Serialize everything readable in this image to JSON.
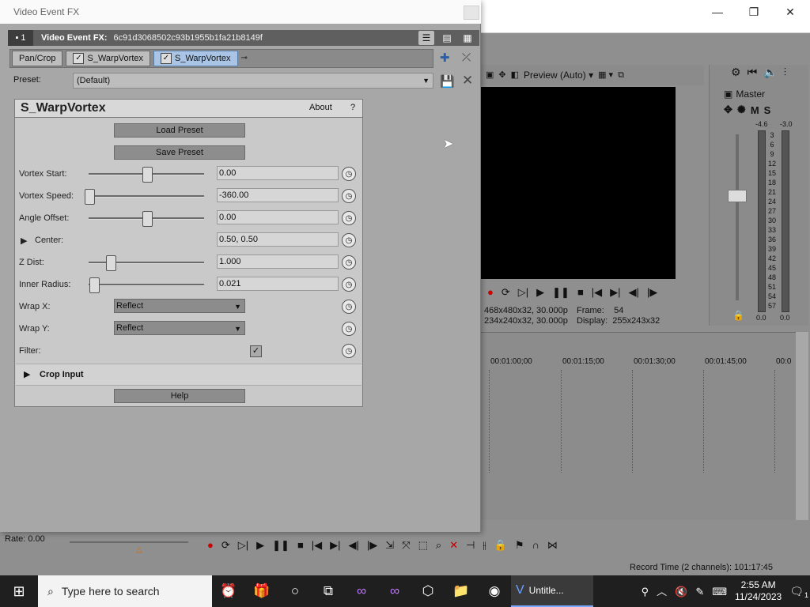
{
  "app": {
    "window_controls": {
      "minimize": "—",
      "maximize": "❐",
      "close": "✕"
    },
    "preview": {
      "mode_label": "Preview (Auto)",
      "info_line1_left": "468x480x32, 30.000p",
      "info_line1_right_label": "Frame:",
      "info_line1_right_value": "54",
      "info_line2_left": "234x240x32, 30.000p",
      "info_line2_right_label": "Display:",
      "info_line2_right_value": "255x243x32"
    },
    "mixer": {
      "title": "Master",
      "m_label": "M",
      "s_label": "S",
      "peak_left": "-4.6",
      "peak_right": "-3.0",
      "scale": [
        "3",
        "6",
        "9",
        "12",
        "15",
        "18",
        "21",
        "24",
        "27",
        "30",
        "33",
        "36",
        "39",
        "42",
        "45",
        "48",
        "51",
        "54",
        "57"
      ],
      "bottom_left": "0.0",
      "bottom_right": "0.0"
    },
    "timeline": {
      "ticks": [
        "00:01:00;00",
        "00:01:15;00",
        "00:01:30;00",
        "00:01:45;00",
        "00:0"
      ]
    },
    "rate": "Rate: 0.00",
    "record_time": "Record Time (2 channels): 101:17:45"
  },
  "fx": {
    "title": "Video Event FX",
    "header": {
      "index": "1",
      "label": "Video Event FX:",
      "hash": "6c91d3068502c93b1955b1fa21b8149f"
    },
    "chain": [
      {
        "label": "Pan/Crop",
        "checkbox": false,
        "active": false
      },
      {
        "label": "S_WarpVortex",
        "checkbox": true,
        "active": false
      },
      {
        "label": "S_WarpVortex",
        "checkbox": true,
        "active": true
      }
    ],
    "preset_label": "Preset:",
    "preset_value": "(Default)",
    "plugin": {
      "title": "S_WarpVortex",
      "about": "About",
      "help_q": "?",
      "load_preset": "Load Preset",
      "save_preset": "Save Preset",
      "help": "Help",
      "params": [
        {
          "label": "Vortex Start:",
          "value": "0.00",
          "slider": 0.5
        },
        {
          "label": "Vortex Speed:",
          "value": "-360.00",
          "slider": 0.0
        },
        {
          "label": "Angle Offset:",
          "value": "0.00",
          "slider": 0.5
        },
        {
          "label": "Center:",
          "value": "0.50, 0.50"
        },
        {
          "label": "Z Dist:",
          "value": "1.000",
          "slider": 0.18
        },
        {
          "label": "Inner Radius:",
          "value": "0.021",
          "slider": 0.03
        },
        {
          "label": "Wrap X:",
          "value": "Reflect"
        },
        {
          "label": "Wrap Y:",
          "value": "Reflect"
        },
        {
          "label": "Filter:",
          "checked": true
        }
      ],
      "crop_input": "Crop Input"
    }
  },
  "taskbar": {
    "search_placeholder": "Type here to search",
    "active_app": "Untitle...",
    "time": "2:55 AM",
    "date": "11/24/2023",
    "notification_count": "1"
  }
}
